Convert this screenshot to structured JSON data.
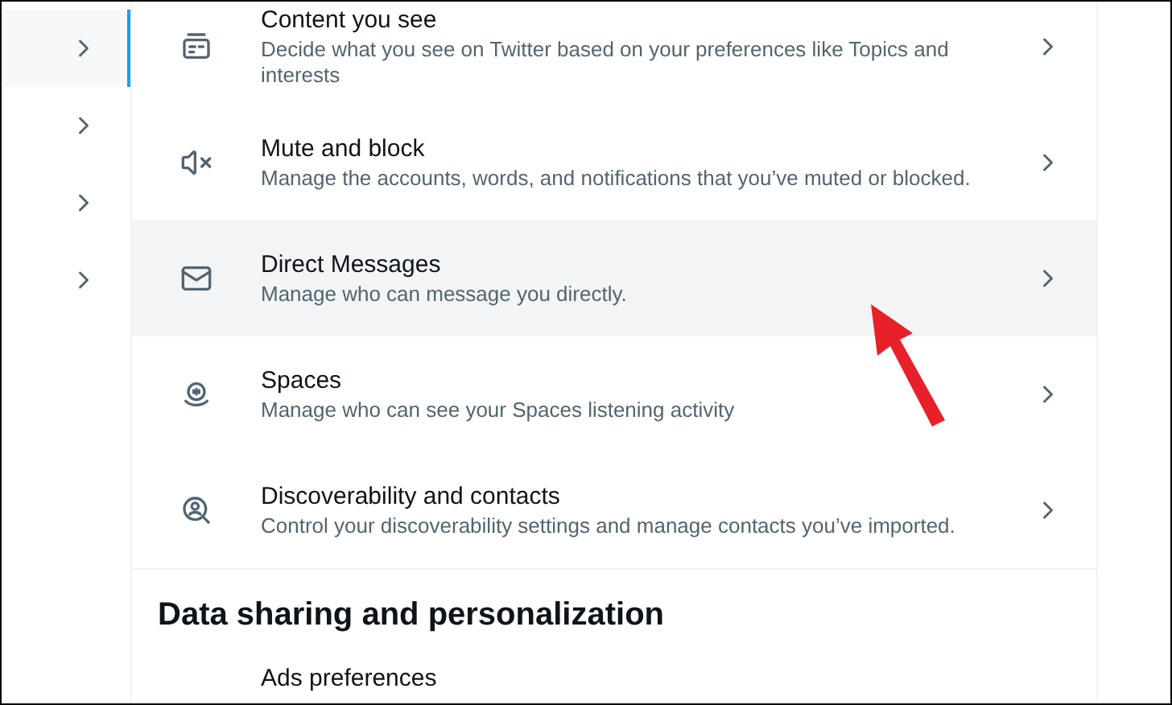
{
  "sidebar": {
    "items": [
      {
        "selected": true
      },
      {
        "selected": false
      },
      {
        "selected": false
      },
      {
        "selected": false
      }
    ]
  },
  "settings": [
    {
      "title": "Content you see",
      "description": "Decide what you see on Twitter based on your preferences like Topics and interests",
      "highlighted": false
    },
    {
      "title": "Mute and block",
      "description": "Manage the accounts, words, and notifications that you’ve muted or blocked.",
      "highlighted": false
    },
    {
      "title": "Direct Messages",
      "description": "Manage who can message you directly.",
      "highlighted": true
    },
    {
      "title": "Spaces",
      "description": "Manage who can see your Spaces listening activity",
      "highlighted": false
    },
    {
      "title": "Discoverability and contacts",
      "description": "Control your discoverability settings and manage contacts you’ve imported.",
      "highlighted": false
    }
  ],
  "section": {
    "heading": "Data sharing and personalization",
    "items": [
      {
        "title": "Ads preferences"
      }
    ]
  }
}
